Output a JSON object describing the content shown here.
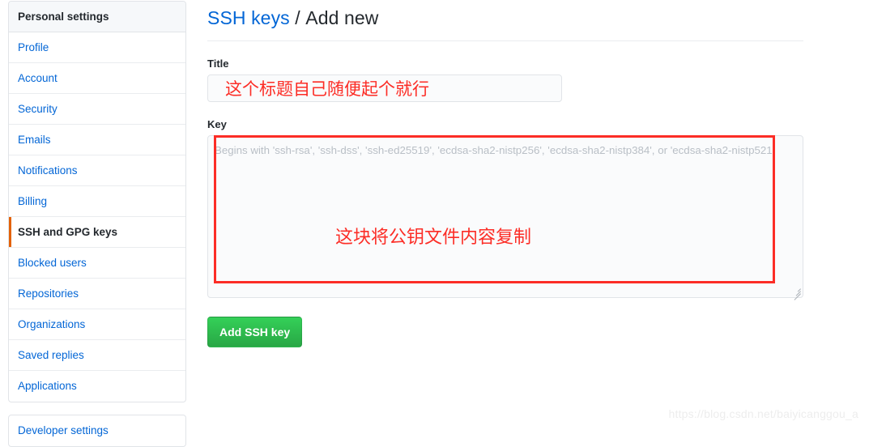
{
  "sidebar": {
    "header": "Personal settings",
    "items": [
      {
        "label": "Profile",
        "selected": false
      },
      {
        "label": "Account",
        "selected": false
      },
      {
        "label": "Security",
        "selected": false
      },
      {
        "label": "Emails",
        "selected": false
      },
      {
        "label": "Notifications",
        "selected": false
      },
      {
        "label": "Billing",
        "selected": false
      },
      {
        "label": "SSH and GPG keys",
        "selected": true
      },
      {
        "label": "Blocked users",
        "selected": false
      },
      {
        "label": "Repositories",
        "selected": false
      },
      {
        "label": "Organizations",
        "selected": false
      },
      {
        "label": "Saved replies",
        "selected": false
      },
      {
        "label": "Applications",
        "selected": false
      }
    ],
    "second_card_items": [
      {
        "label": "Developer settings",
        "selected": false
      }
    ]
  },
  "header": {
    "breadcrumb_link": "SSH keys",
    "breadcrumb_separator": "/",
    "breadcrumb_current": "Add new"
  },
  "form": {
    "title_label": "Title",
    "title_value": "",
    "title_placeholder": "",
    "key_label": "Key",
    "key_value": "",
    "key_placeholder": "Begins with 'ssh-rsa', 'ssh-dss', 'ssh-ed25519', 'ecdsa-sha2-nistp256', 'ecdsa-sha2-nistp384', or 'ecdsa-sha2-nistp521'",
    "submit_label": "Add SSH key"
  },
  "annotations": {
    "title_note": "这个标题自己随便起个就行",
    "key_note": "这块将公钥文件内容复制"
  },
  "watermark": {
    "text": "https://blog.csdn.net/baiyicanggou_a"
  },
  "colors": {
    "link": "#0366d6",
    "text": "#24292e",
    "selected_indicator": "#e36209",
    "button_green": "#2cbe4e",
    "annotation_red": "#fc2d26",
    "border": "#e1e4e8",
    "input_bg": "#fafbfc"
  }
}
